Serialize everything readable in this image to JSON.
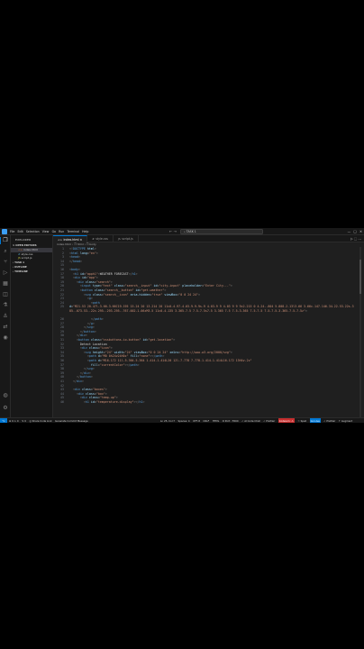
{
  "titlebar": {
    "menus": [
      "File",
      "Edit",
      "Selection",
      "View",
      "Go",
      "Run",
      "Terminal",
      "Help"
    ],
    "nav": "← →",
    "search": "⌕ TASK 1",
    "window_controls": [
      "—",
      "□",
      "✕"
    ]
  },
  "activity": [
    "explorer-icon",
    "search-icon",
    "source-control-icon",
    "run-debug-icon",
    "extensions-icon",
    "remote-icon",
    "testing-icon",
    "docker-icon",
    "live-share-icon",
    "copilot-icon",
    "accounts-icon",
    "settings-icon"
  ],
  "sidebar": {
    "title": "EXPLORER",
    "open_editors": "∨ OPEN EDITORS",
    "files": [
      {
        "ext": "<>",
        "name": "index.html"
      },
      {
        "ext": "#",
        "name": "style.css"
      },
      {
        "ext": "JS",
        "name": "script.js"
      }
    ],
    "sections": [
      "› TASK 1",
      "› OUTLINE",
      "› TIMELINE"
    ]
  },
  "tabs": [
    {
      "icon": "<>",
      "label": "index.html ×",
      "active": true
    },
    {
      "icon": "#",
      "label": "style.css",
      "active": false
    },
    {
      "icon": "JS",
      "label": "script.js",
      "active": false
    }
  ],
  "tabs_actions": "▷  ⬚  …",
  "breadcrumb": "index.html › ❐ html › ❐ body",
  "editor": {
    "lines": [
      {
        "n": "1",
        "html": "<span class=\"p\">&lt;!</span><span class=\"t\">DOCTYPE</span> <span class=\"a\">html</span><span class=\"p\">&gt;</span>"
      },
      {
        "n": "2",
        "html": "<span class=\"p\">&lt;</span><span class=\"t\">html</span> <span class=\"a\">lang</span>=<span class=\"s\">\"en\"</span><span class=\"p\">&gt;</span>"
      },
      {
        "n": "3",
        "html": "<span class=\"p\">&lt;</span><span class=\"t\">head</span><span class=\"p\">&gt;</span>"
      },
      {
        "n": "14",
        "html": "<span class=\"p\">&lt;/</span><span class=\"t\">head</span><span class=\"p\">&gt;</span>"
      },
      {
        "n": "15",
        "html": ""
      },
      {
        "n": "16",
        "html": "<span class=\"p\">&lt;</span><span class=\"t\">body</span><span class=\"p\">&gt;</span>"
      },
      {
        "n": "17",
        "html": "  <span class=\"p\">&lt;</span><span class=\"t\">h1</span> <span class=\"a\">id</span>=<span class=\"s\">\"apph1\"</span><span class=\"p\">&gt;</span><span class=\"x\">WEATHER FORECAST</span><span class=\"p\">&lt;/</span><span class=\"t\">h1</span><span class=\"p\">&gt;</span>"
      },
      {
        "n": "18",
        "html": "  <span class=\"p\">&lt;</span><span class=\"t\">div</span> <span class=\"a\">id</span>=<span class=\"s\">\"app\"</span><span class=\"p\">&gt;</span>"
      },
      {
        "n": "19",
        "html": "    <span class=\"p\">&lt;</span><span class=\"t\">div</span> <span class=\"a\">class</span>=<span class=\"s\">\"search\"</span><span class=\"p\">&gt;</span>"
      },
      {
        "n": "20",
        "html": "      <span class=\"p\">&lt;</span><span class=\"t\">input</span> <span class=\"a\">type</span>=<span class=\"s\">\"text\"</span> <span class=\"a\">class</span>=<span class=\"s\">\"search__input\"</span> <span class=\"a\">id</span>=<span class=\"s\">\"city-input\"</span> <span class=\"a\">placeholder</span>=<span class=\"s\">\"Enter City...\"</span><span class=\"p\">&gt;</span>"
      },
      {
        "n": "21",
        "html": "      <span class=\"p\">&lt;</span><span class=\"t\">button</span> <span class=\"a\">class</span>=<span class=\"s\">\"search__button\"</span> <span class=\"a\">id</span>=<span class=\"s\">\"get-weather\"</span><span class=\"p\">&gt;</span>"
      },
      {
        "n": "22",
        "html": "        <span class=\"p\">&lt;</span><span class=\"t\">svg</span> <span class=\"a\">class</span>=<span class=\"s\">\"search__icon\"</span> <span class=\"a\">aria-hidden</span>=<span class=\"s\">\"true\"</span> <span class=\"a\">viewBox</span>=<span class=\"s\">\"0 0 24 24\"</span><span class=\"p\">&gt;</span>"
      },
      {
        "n": "23",
        "html": "          <span class=\"p\">&lt;</span><span class=\"t\">g</span><span class=\"p\">&gt;</span>"
      },
      {
        "n": "24",
        "html": "            <span class=\"p\">&lt;</span><span class=\"t\">path</span>"
      },
      {
        "n": "25",
        "wrap": true,
        "html": "              <span class=\"a\">d</span>=<span class=\"s\">\"M21.53 20.47l-3.66-3.66C19.195 15.24 20 13.214 20 11c0-4.97-4.03-9-9-9s-9 4.03-9 9 4.03 9 9 9c2.215 0 4.24-.804 5.808-2.13l3.66 3.66c.147.146.34.22.53.22s.385-.073.53-.22c.295-.293.295-.767.002-1.06zM3.5 11c0-4.135 3.365-7.5 7.5-7.5s7.5 3.365 7.5 7.5-3.365 7.5-7.5 7.5-7.5-3.365-7.5-7.5z\"</span><span class=\"p\">&gt;</span>"
      },
      {
        "n": "26",
        "html": "            <span class=\"p\">&lt;/</span><span class=\"t\">path</span><span class=\"p\">&gt;</span>"
      },
      {
        "n": "27",
        "html": "          <span class=\"p\">&lt;/</span><span class=\"t\">g</span><span class=\"p\">&gt;</span>"
      },
      {
        "n": "28",
        "html": "        <span class=\"p\">&lt;/</span><span class=\"t\">svg</span><span class=\"p\">&gt;</span>"
      },
      {
        "n": "29",
        "html": "      <span class=\"p\">&lt;/</span><span class=\"t\">button</span><span class=\"p\">&gt;</span>"
      },
      {
        "n": "30",
        "html": "    <span class=\"p\">&lt;/</span><span class=\"t\">div</span><span class=\"p\">&gt;</span>"
      },
      {
        "n": "31",
        "html": "    <span class=\"p\">&lt;</span><span class=\"t\">button</span> <span class=\"a\">class</span>=<span class=\"s\">\"cssbuttons-io-button\"</span> <span class=\"a\">id</span>=<span class=\"s\">\"get-location\"</span><span class=\"p\">&gt;</span>"
      },
      {
        "n": "32",
        "html": "      <span class=\"x\">Detect Location</span>"
      },
      {
        "n": "33",
        "html": "      <span class=\"p\">&lt;</span><span class=\"t\">div</span> <span class=\"a\">class</span>=<span class=\"s\">\"icon\"</span><span class=\"p\">&gt;</span>"
      },
      {
        "n": "34",
        "html": "        <span class=\"p\">&lt;</span><span class=\"t\">svg</span> <span class=\"a\">height</span>=<span class=\"s\">\"24\"</span> <span class=\"a\">width</span>=<span class=\"s\">\"24\"</span> <span class=\"a\">viewBox</span>=<span class=\"s\">\"0 0 24 24\"</span> <span class=\"a\">xmlns</span>=<span class=\"s\">\"http://www.w3.org/2000/svg\"</span><span class=\"p\">&gt;</span>"
      },
      {
        "n": "35",
        "html": "          <span class=\"p\">&lt;</span><span class=\"t\">path</span> <span class=\"a\">d</span>=<span class=\"s\">\"M0 0h24v24H0z\"</span> <span class=\"a\">fill</span>=<span class=\"s\">\"none\"</span><span class=\"p\">&gt;&lt;/</span><span class=\"t\">path</span><span class=\"p\">&gt;</span>"
      },
      {
        "n": "36",
        "html": "          <span class=\"p\">&lt;</span><span class=\"t\">path</span> <span class=\"a\">d</span>=<span class=\"s\">\"M16.172 11l-5.364-5.364 1.414-1.414L20 12l-7.778 7.778-1.414-1.414L16.172 13H4v-2z\"</span>"
      },
      {
        "n": "37",
        "html": "            <span class=\"a\">fill</span>=<span class=\"s\">\"currentColor\"</span><span class=\"p\">&gt;&lt;/</span><span class=\"t\">path</span><span class=\"p\">&gt;</span>"
      },
      {
        "n": "38",
        "html": "        <span class=\"p\">&lt;/</span><span class=\"t\">svg</span><span class=\"p\">&gt;</span>"
      },
      {
        "n": "39",
        "html": "      <span class=\"p\">&lt;/</span><span class=\"t\">div</span><span class=\"p\">&gt;</span>"
      },
      {
        "n": "40",
        "html": "    <span class=\"p\">&lt;/</span><span class=\"t\">button</span><span class=\"p\">&gt;</span>"
      },
      {
        "n": "41",
        "html": "  <span class=\"p\">&lt;/</span><span class=\"t\">div</span><span class=\"p\">&gt;</span>"
      },
      {
        "n": "42",
        "html": ""
      },
      {
        "n": "43",
        "html": "  <span class=\"p\">&lt;</span><span class=\"t\">div</span> <span class=\"a\">class</span>=<span class=\"s\">\"boxes\"</span><span class=\"p\">&gt;</span>"
      },
      {
        "n": "44",
        "html": "    <span class=\"p\">&lt;</span><span class=\"t\">div</span> <span class=\"a\">class</span>=<span class=\"s\">\"box\"</span><span class=\"p\">&gt;</span>"
      },
      {
        "n": "45",
        "html": "      <span class=\"p\">&lt;</span><span class=\"t\">div</span> <span class=\"a\">class</span>=<span class=\"s\">\"temp-up\"</span><span class=\"p\">&gt;</span>"
      },
      {
        "n": "46",
        "html": "        <span class=\"p\">&lt;</span><span class=\"t\">h1</span> <span class=\"a\">id</span>=<span class=\"s\">\"temperature-display\"</span><span class=\"p\">&gt;&lt;/</span><span class=\"t\">h1</span><span class=\"p\">&gt;</span>"
      }
    ]
  },
  "statusbar": {
    "remote": "⌥",
    "left": [
      "⊗ 0 ⚠ 0",
      "↯ 0",
      "◎ Share Code Link",
      "Generate Commit Message"
    ],
    "right": [
      "Ln 25, Col 7",
      "Spaces: 4",
      "UTF-8",
      "CRLF",
      "HTML",
      "✉ Port : 5500",
      "✓ AI Code Chat",
      "✓ Prettier"
    ],
    "warn": "Codeium: ⚠",
    "live": "Go Live",
    "tail": [
      "☆ Spell",
      "✓ Prettier",
      "↑ Augment"
    ]
  }
}
